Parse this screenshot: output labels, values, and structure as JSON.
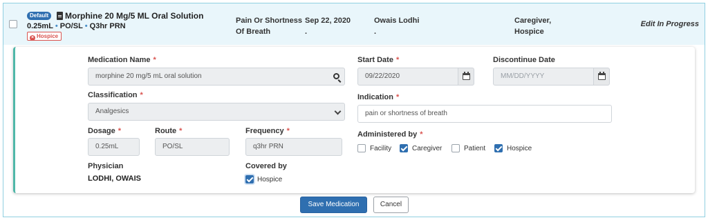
{
  "row": {
    "default_badge": "Default",
    "med_title": "Morphine 20 Mg/5 ML Oral Solution",
    "dose": "0.25mL",
    "route": "PO/SL",
    "frequency": "Q3hr PRN",
    "dot": "•",
    "hospice_tag": "Hospice",
    "indication_line1": "Pain Or Shortness",
    "indication_line2": "Of Breath",
    "date": "Sep 22, 2020",
    "date_sub": ".",
    "physician": "Owais Lodhi",
    "physician_sub": ".",
    "admin_line1": "Caregiver,",
    "admin_line2": "Hospice",
    "status": "Edit In Progress"
  },
  "form": {
    "medication_name": {
      "label": "Medication Name",
      "value": "morphine 20 mg/5 mL oral solution"
    },
    "start_date": {
      "label": "Start Date",
      "value": "09/22/2020"
    },
    "discontinue_date": {
      "label": "Discontinue Date",
      "placeholder": "MM/DD/YYYY"
    },
    "classification": {
      "label": "Classification",
      "value": "Analgesics"
    },
    "indication": {
      "label": "Indication",
      "value": "pain or shortness of breath"
    },
    "dosage": {
      "label": "Dosage",
      "value": "0.25mL"
    },
    "route": {
      "label": "Route",
      "value": "PO/SL"
    },
    "frequency": {
      "label": "Frequency",
      "value": "q3hr PRN"
    },
    "administered_by": {
      "label": "Administered by",
      "options": [
        {
          "label": "Facility",
          "checked": false
        },
        {
          "label": "Caregiver",
          "checked": true
        },
        {
          "label": "Patient",
          "checked": false
        },
        {
          "label": "Hospice",
          "checked": true
        }
      ]
    },
    "physician": {
      "label": "Physician",
      "value": "LODHI, OWAIS"
    },
    "covered_by": {
      "label": "Covered by",
      "option": "Hospice",
      "checked": true
    },
    "required_mark": "*"
  },
  "actions": {
    "save_label": "Save Medication",
    "cancel_label": "Cancel"
  },
  "colors": {
    "primary": "#2f6fb0",
    "accent_bar": "#4fb7a8",
    "required": "#d9534f",
    "header_bg": "#e9f6fb"
  }
}
